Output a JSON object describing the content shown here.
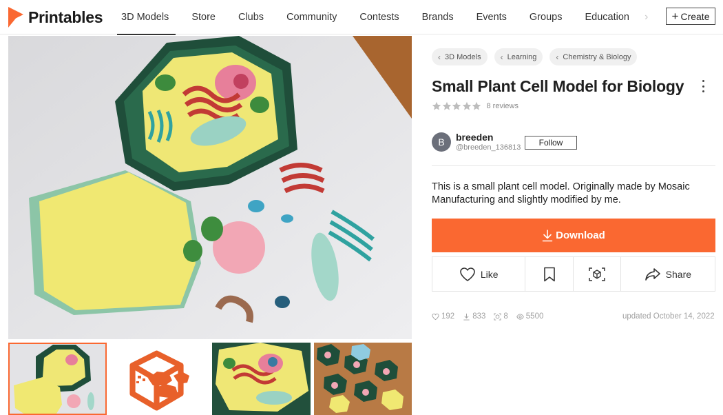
{
  "header": {
    "logo_text": "Printables",
    "nav": [
      {
        "label": "3D Models",
        "active": true
      },
      {
        "label": "Store"
      },
      {
        "label": "Clubs"
      },
      {
        "label": "Community"
      },
      {
        "label": "Contests"
      },
      {
        "label": "Brands"
      },
      {
        "label": "Events"
      },
      {
        "label": "Groups"
      },
      {
        "label": "Education"
      }
    ],
    "more_glyph": "›",
    "create_plus": "+",
    "create_label": "Create"
  },
  "breadcrumbs": [
    {
      "label": "3D Models"
    },
    {
      "label": "Learning"
    },
    {
      "label": "Chemistry & Biology"
    }
  ],
  "model": {
    "title": "Small Plant Cell Model for Biology",
    "rating": 5,
    "reviews_label": "8 reviews",
    "description": "This is a small plant cell model. Originally made by Mosaic Manufacturing and slightly modified by me."
  },
  "author": {
    "initial": "B",
    "name": "breeden",
    "handle": "@breeden_136813",
    "follow_label": "Follow"
  },
  "download_label": "Download",
  "actions": {
    "like_label": "Like",
    "share_label": "Share"
  },
  "stats": {
    "likes": "192",
    "downloads": "833",
    "makes": "8",
    "views": "5500",
    "updated": "updated October 14, 2022"
  },
  "icons": [
    "printables-logo",
    "chevron-left-icon",
    "chevron-right-icon",
    "star-icon",
    "kebab-icon",
    "download-icon",
    "heart-icon",
    "bookmark-icon",
    "3d-view-icon",
    "share-icon",
    "eye-icon",
    "cube-icon"
  ],
  "colors": {
    "accent": "#fa6831",
    "text": "#222222",
    "muted": "#a0a0a0",
    "star": "#bdbdbd",
    "avatar": "#6b6f7a"
  }
}
